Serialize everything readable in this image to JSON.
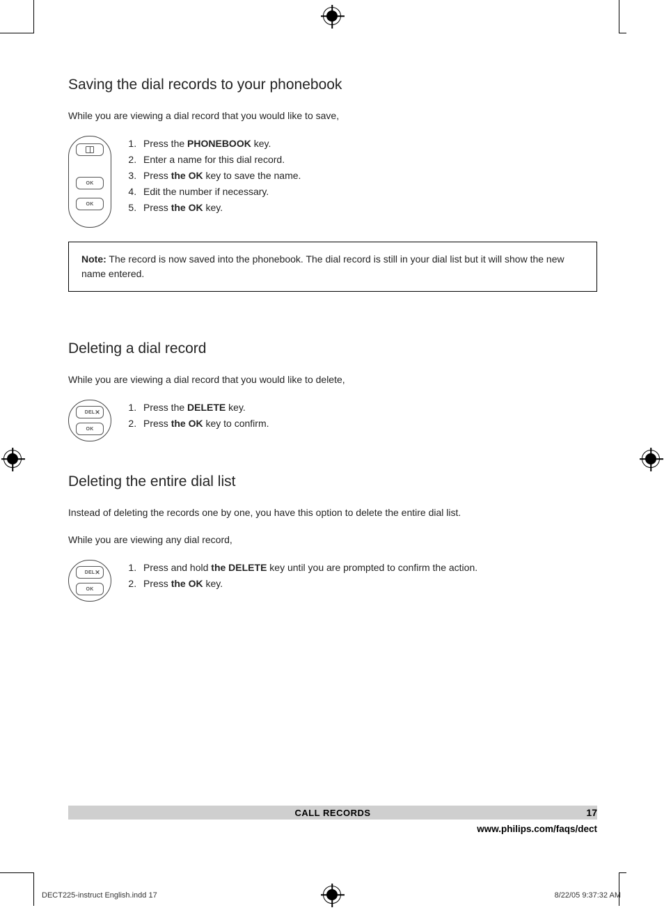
{
  "section1": {
    "heading": "Saving the dial records to your phonebook",
    "intro": "While you are viewing a dial record that you would like to save,",
    "steps": [
      {
        "pre": "Press the ",
        "bold": "PHONEBOOK",
        "post": " key."
      },
      {
        "pre": "Enter a name for this dial record.",
        "bold": "",
        "post": ""
      },
      {
        "pre": "Press ",
        "bold": "the OK",
        "post": " key to save the name."
      },
      {
        "pre": "Edit the number if necessary.",
        "bold": "",
        "post": ""
      },
      {
        "pre": "Press ",
        "bold": "the OK",
        "post": " key."
      }
    ],
    "note_label": "Note:",
    "note_body": " The record is now saved into the phonebook.  The dial record is still in your dial list but it will show the new name entered."
  },
  "section2": {
    "heading": "Deleting a dial record",
    "intro": "While you are viewing a dial record that you would like to delete,",
    "steps": [
      {
        "pre": "Press the ",
        "bold": "DELETE",
        "post": " key."
      },
      {
        "pre": "Press ",
        "bold": "the OK",
        "post": " key to confirm."
      }
    ]
  },
  "section3": {
    "heading": "Deleting the entire dial list",
    "intro1": "Instead of deleting the records one by one, you have this option to delete the entire dial list.",
    "intro2": "While you are viewing any dial record,",
    "steps": [
      {
        "pre": "Press and hold ",
        "bold": "the DELETE",
        "post": " key until you are prompted to confirm the action."
      },
      {
        "pre": "Press ",
        "bold": "the OK",
        "post": " key."
      }
    ]
  },
  "keys": {
    "ok": "OK",
    "del": "DEL"
  },
  "footer": {
    "bar": "CALL RECORDS",
    "page": "17",
    "url": "www.philips.com/faqs/dect"
  },
  "slug": {
    "left": "DECT225-instruct English.indd   17",
    "right": "8/22/05   9:37:32 AM"
  }
}
